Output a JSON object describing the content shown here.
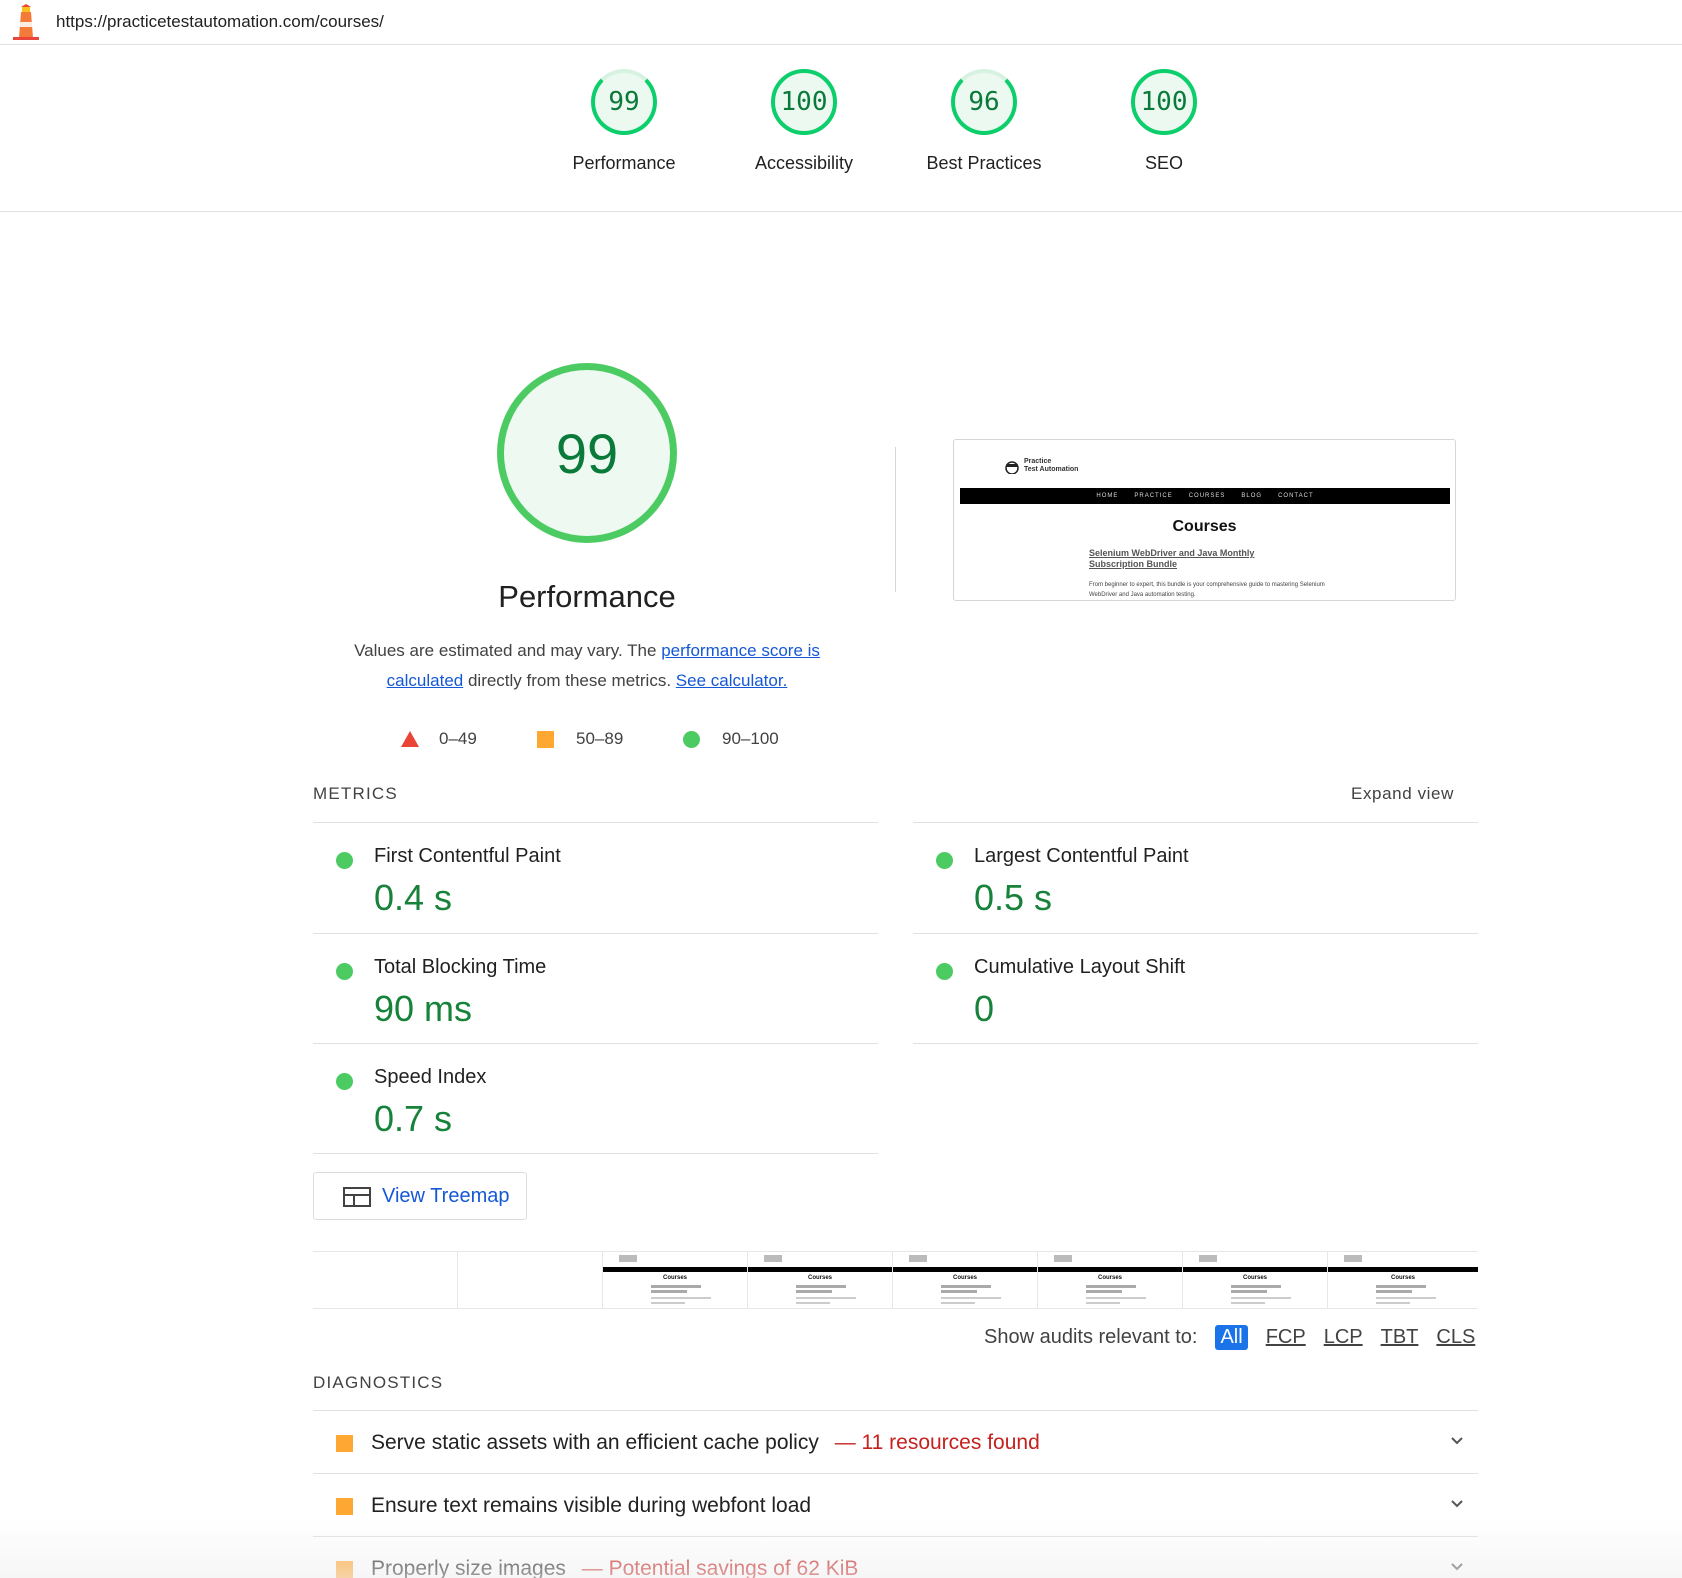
{
  "url": "https://practicetestautomation.com/courses/",
  "categories": [
    {
      "label": "Performance",
      "score": "99"
    },
    {
      "label": "Accessibility",
      "score": "100"
    },
    {
      "label": "Best Practices",
      "score": "96"
    },
    {
      "label": "SEO",
      "score": "100"
    }
  ],
  "performance": {
    "score": "99",
    "title": "Performance",
    "desc_prefix": "Values are estimated and may vary. The ",
    "desc_link1": "performance score is calculated",
    "desc_middle": " directly from these metrics. ",
    "desc_link2": "See calculator.",
    "legend": {
      "fail": "0–49",
      "average": "50–89",
      "pass": "90–100"
    },
    "screenshot": {
      "brand_line1": "Practice",
      "brand_line2": "Test Automation",
      "nav": [
        "HOME",
        "PRACTICE",
        "COURSES",
        "BLOG",
        "CONTACT"
      ],
      "heading": "Courses",
      "link": "Selenium WebDriver and Java Monthly Subscription Bundle",
      "text": "From beginner to expert, this bundle is your comprehensive guide to mastering Selenium WebDriver and Java automation testing."
    }
  },
  "metrics": {
    "header": "METRICS",
    "expand": "Expand view",
    "items": [
      {
        "name": "First Contentful Paint",
        "value": "0.4 s"
      },
      {
        "name": "Largest Contentful Paint",
        "value": "0.5 s"
      },
      {
        "name": "Total Blocking Time",
        "value": "90 ms"
      },
      {
        "name": "Cumulative Layout Shift",
        "value": "0"
      },
      {
        "name": "Speed Index",
        "value": "0.7 s"
      }
    ]
  },
  "treemap": {
    "label": "View Treemap"
  },
  "filmstrip": {
    "frame_title": "Courses"
  },
  "filters": {
    "label": "Show audits relevant to:",
    "options": [
      "All",
      "FCP",
      "LCP",
      "TBT",
      "CLS"
    ]
  },
  "diagnostics": {
    "header": "DIAGNOSTICS",
    "items": [
      {
        "title": "Serve static assets with an efficient cache policy",
        "extra": "— 11 resources found"
      },
      {
        "title": "Ensure text remains visible during webfont load",
        "extra": ""
      },
      {
        "title": "Properly size images",
        "extra": "— Potential savings of 62 KiB"
      }
    ]
  },
  "colors": {
    "pass": "#0cce6b",
    "average": "#ffa733",
    "fail": "#eb4335",
    "link": "#1558d6"
  }
}
